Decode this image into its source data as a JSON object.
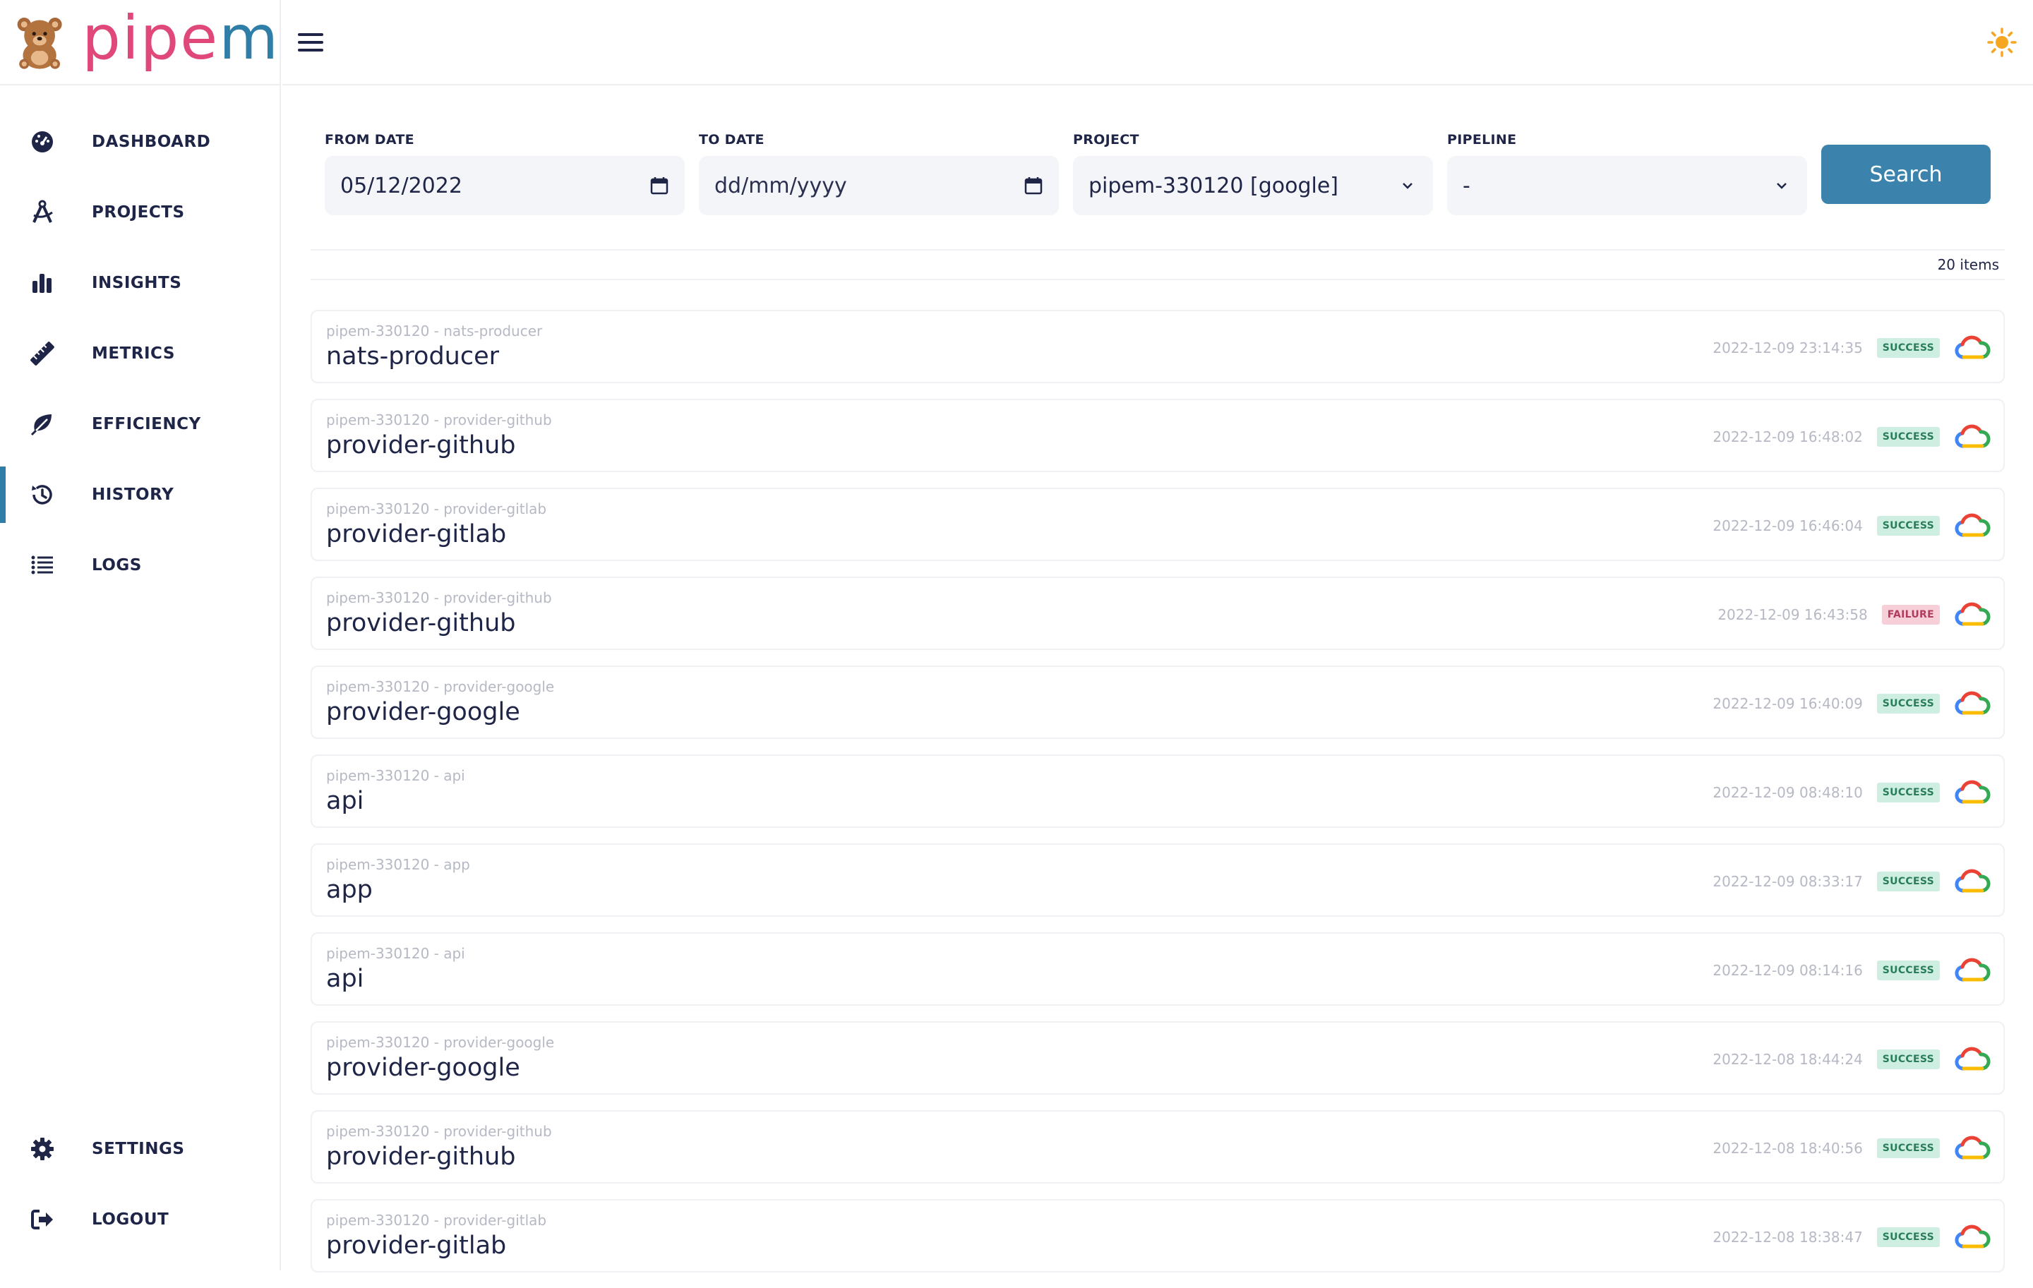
{
  "brand": {
    "name_part1": "pipe",
    "name_part2": "m"
  },
  "sidebar": {
    "items": [
      {
        "label": "DASHBOARD",
        "icon": "speedometer-icon"
      },
      {
        "label": "PROJECTS",
        "icon": "compass-icon"
      },
      {
        "label": "INSIGHTS",
        "icon": "bar-chart-icon"
      },
      {
        "label": "METRICS",
        "icon": "ruler-icon"
      },
      {
        "label": "EFFICIENCY",
        "icon": "leaf-icon"
      },
      {
        "label": "HISTORY",
        "icon": "history-icon",
        "active": true
      },
      {
        "label": "LOGS",
        "icon": "list-icon"
      }
    ],
    "bottom_items": [
      {
        "label": "SETTINGS",
        "icon": "gear-icon"
      },
      {
        "label": "LOGOUT",
        "icon": "logout-icon"
      }
    ]
  },
  "filters": {
    "from_date": {
      "label": "FROM DATE",
      "value": "05/12/2022"
    },
    "to_date": {
      "label": "TO DATE",
      "placeholder": "dd/mm/yyyy"
    },
    "project": {
      "label": "PROJECT",
      "value": "pipem-330120 [google]"
    },
    "pipeline": {
      "label": "PIPELINE",
      "value": "-"
    },
    "search_label": "Search"
  },
  "count_text": "20 items",
  "colors": {
    "accent": "#3b82ad",
    "success_bg": "#cdeee0",
    "failure_bg": "#f7cfd9"
  },
  "runs": [
    {
      "subtitle": "pipem-330120 - nats-producer",
      "title": "nats-producer",
      "time": "2022-12-09 23:14:35",
      "status": "SUCCESS"
    },
    {
      "subtitle": "pipem-330120 - provider-github",
      "title": "provider-github",
      "time": "2022-12-09 16:48:02",
      "status": "SUCCESS"
    },
    {
      "subtitle": "pipem-330120 - provider-gitlab",
      "title": "provider-gitlab",
      "time": "2022-12-09 16:46:04",
      "status": "SUCCESS"
    },
    {
      "subtitle": "pipem-330120 - provider-github",
      "title": "provider-github",
      "time": "2022-12-09 16:43:58",
      "status": "FAILURE"
    },
    {
      "subtitle": "pipem-330120 - provider-google",
      "title": "provider-google",
      "time": "2022-12-09 16:40:09",
      "status": "SUCCESS"
    },
    {
      "subtitle": "pipem-330120 - api",
      "title": "api",
      "time": "2022-12-09 08:48:10",
      "status": "SUCCESS"
    },
    {
      "subtitle": "pipem-330120 - app",
      "title": "app",
      "time": "2022-12-09 08:33:17",
      "status": "SUCCESS"
    },
    {
      "subtitle": "pipem-330120 - api",
      "title": "api",
      "time": "2022-12-09 08:14:16",
      "status": "SUCCESS"
    },
    {
      "subtitle": "pipem-330120 - provider-google",
      "title": "provider-google",
      "time": "2022-12-08 18:44:24",
      "status": "SUCCESS"
    },
    {
      "subtitle": "pipem-330120 - provider-github",
      "title": "provider-github",
      "time": "2022-12-08 18:40:56",
      "status": "SUCCESS"
    },
    {
      "subtitle": "pipem-330120 - provider-gitlab",
      "title": "provider-gitlab",
      "time": "2022-12-08 18:38:47",
      "status": "SUCCESS"
    }
  ]
}
